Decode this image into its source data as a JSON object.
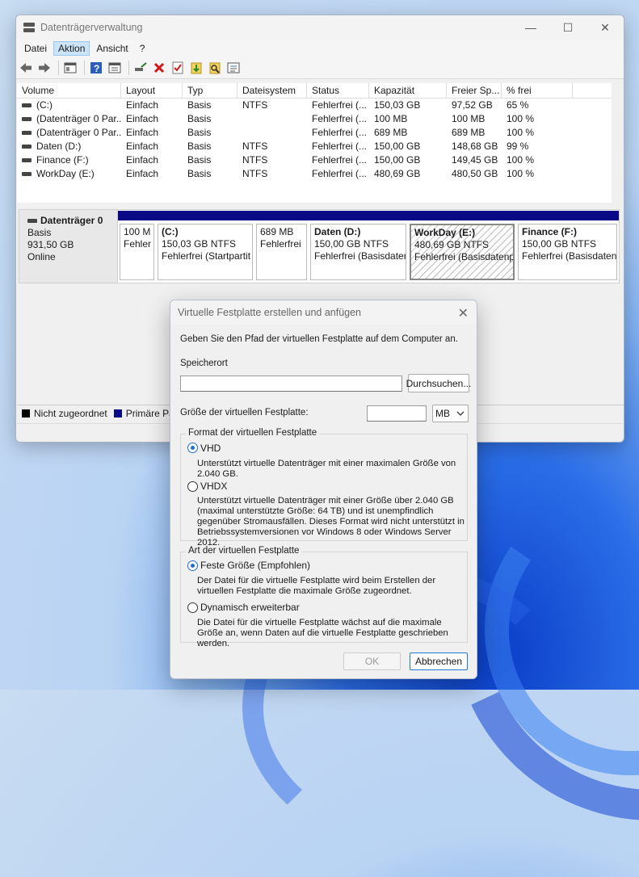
{
  "window": {
    "title": "Datenträgerverwaltung",
    "controls": [
      "—",
      "☐",
      "✕"
    ]
  },
  "menu": [
    "Datei",
    "Aktion",
    "Ansicht",
    "?"
  ],
  "menu_active": "Aktion",
  "toolbar_icons": [
    "back-icon",
    "forward-icon",
    "console-tree-icon",
    "help-icon",
    "properties-icon",
    "connect-disk-icon",
    "delete-icon",
    "check-icon",
    "import-icon",
    "search-icon",
    "settings-list-icon"
  ],
  "list": {
    "columns": [
      "Volume",
      "Layout",
      "Typ",
      "Dateisystem",
      "Status",
      "Kapazität",
      "Freier Sp...",
      "% frei"
    ],
    "rows": [
      [
        "(C:)",
        "Einfach",
        "Basis",
        "NTFS",
        "Fehlerfrei (...",
        "150,03 GB",
        "97,52 GB",
        "65 %"
      ],
      [
        "(Datenträger 0 Par...",
        "Einfach",
        "Basis",
        "",
        "Fehlerfrei (...",
        "100 MB",
        "100 MB",
        "100 %"
      ],
      [
        "(Datenträger 0 Par...",
        "Einfach",
        "Basis",
        "",
        "Fehlerfrei (...",
        "689 MB",
        "689 MB",
        "100 %"
      ],
      [
        "Daten (D:)",
        "Einfach",
        "Basis",
        "NTFS",
        "Fehlerfrei (...",
        "150,00 GB",
        "148,68 GB",
        "99 %"
      ],
      [
        "Finance (F:)",
        "Einfach",
        "Basis",
        "NTFS",
        "Fehlerfrei (...",
        "150,00 GB",
        "149,45 GB",
        "100 %"
      ],
      [
        "WorkDay (E:)",
        "Einfach",
        "Basis",
        "NTFS",
        "Fehlerfrei (...",
        "480,69 GB",
        "480,50 GB",
        "100 %"
      ]
    ]
  },
  "disk": {
    "name": "Datenträger 0",
    "type": "Basis",
    "size": "931,50 GB",
    "state": "Online",
    "partitions": [
      {
        "name": "",
        "line1": "100 M",
        "line2": "Fehler"
      },
      {
        "name": "(C:)",
        "line1": "150,03 GB NTFS",
        "line2": "Fehlerfrei (Startpartit"
      },
      {
        "name": "",
        "line1": "689 MB",
        "line2": "Fehlerfrei"
      },
      {
        "name": "Daten  (D:)",
        "line1": "150,00 GB NTFS",
        "line2": "Fehlerfrei (Basisdater"
      },
      {
        "name": "WorkDay  (E:)",
        "line1": "480,69 GB NTFS",
        "line2": "Fehlerfrei (Basisdatenp"
      },
      {
        "name": "Finance  (F:)",
        "line1": "150,00 GB NTFS",
        "line2": "Fehlerfrei (Basisdaten"
      }
    ]
  },
  "legend": {
    "unallocated": "Nicht zugeordnet",
    "primary": "Primäre Pa",
    "unallocated_color": "#000000",
    "primary_color": "#0a0a86"
  },
  "dialog": {
    "title": "Virtuelle Festplatte erstellen und anfügen",
    "intro": "Geben Sie den Pfad der virtuellen Festplatte auf dem Computer an.",
    "location_label": "Speicherort",
    "location_value": "",
    "browse": "Durchsuchen...",
    "size_label": "Größe der virtuellen Festplatte:",
    "size_value": "",
    "unit": "MB",
    "format_group": "Format der virtuellen Festplatte",
    "vhd_label": "VHD",
    "vhd_desc": "Unterstützt virtuelle Datenträger mit einer maximalen Größe von 2.040 GB.",
    "vhdx_label": "VHDX",
    "vhdx_desc": "Unterstützt virtuelle Datenträger mit einer Größe über 2.040 GB (maximal unterstützte Größe: 64 TB) und ist unempfindlich gegenüber Stromausfällen. Dieses Format wird nicht unterstützt in Betriebssystemversionen vor Windows 8 oder Windows Server 2012.",
    "type_group": "Art der virtuellen Festplatte",
    "fixed_label": "Feste Größe (Empfohlen)",
    "fixed_desc": "Der Datei für die virtuelle Festplatte wird beim Erstellen der virtuellen Festplatte die maximale Größe zugeordnet.",
    "dynamic_label": "Dynamisch erweiterbar",
    "dynamic_desc": "Die Datei für die virtuelle Festplatte wächst auf die maximale Größe an, wenn Daten auf die virtuelle Festplatte geschrieben werden.",
    "ok": "OK",
    "cancel": "Abbrechen"
  }
}
